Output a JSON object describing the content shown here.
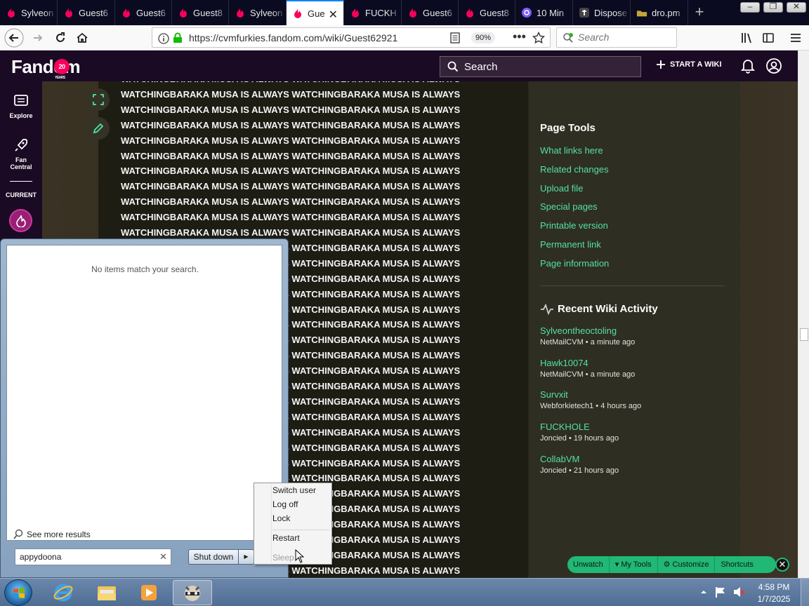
{
  "browser": {
    "tabs": [
      {
        "label": "Sylveon",
        "icon": "fandom-icon"
      },
      {
        "label": "Guest6",
        "icon": "fandom-icon"
      },
      {
        "label": "Guest6",
        "icon": "fandom-icon"
      },
      {
        "label": "Guest8",
        "icon": "fandom-icon"
      },
      {
        "label": "Sylveon",
        "icon": "fandom-icon"
      },
      {
        "label": "Gue",
        "icon": "fandom-icon",
        "active": true
      },
      {
        "label": "FUCKH",
        "icon": "fandom-icon"
      },
      {
        "label": "Guest6",
        "icon": "fandom-icon"
      },
      {
        "label": "Guest8",
        "icon": "fandom-icon"
      },
      {
        "label": "10 Min",
        "icon": "at-icon"
      },
      {
        "label": "Dispose",
        "icon": "t-icon"
      },
      {
        "label": "dro.pm",
        "icon": "dro-icon"
      }
    ],
    "url": "https://cvmfurkies.fandom.com/wiki/Guest62921",
    "zoom": "90%",
    "search_placeholder": "Search"
  },
  "fandom": {
    "logo": "Fandom",
    "logo_badge": "20",
    "logo_years": "YEARS",
    "search_label": "Search",
    "start_wiki": "START A WIKI",
    "nav": {
      "explore": "Explore",
      "fan_central_1": "Fan",
      "fan_central_2": "Central",
      "current": "CURRENT"
    }
  },
  "article": {
    "lines": [
      "WATCHINGBARAKA MUSA IS ALWAYS WATCHINGBARAKA MUSA IS ALWAYS",
      "WATCHINGBARAKA MUSA IS ALWAYS WATCHINGBARAKA MUSA IS ALWAYS",
      "WATCHINGBARAKA MUSA IS ALWAYS WATCHINGBARAKA MUSA IS ALWAYS",
      "WATCHINGBARAKA MUSA IS ALWAYS WATCHINGBARAKA MUSA IS ALWAYS",
      "WATCHINGBARAKA MUSA IS ALWAYS WATCHINGBARAKA MUSA IS ALWAYS",
      "WATCHINGBARAKA MUSA IS ALWAYS WATCHINGBARAKA MUSA IS ALWAYS",
      "WATCHINGBARAKA MUSA IS ALWAYS WATCHINGBARAKA MUSA IS ALWAYS",
      "WATCHINGBARAKA MUSA IS ALWAYS WATCHINGBARAKA MUSA IS ALWAYS",
      "WATCHINGBARAKA MUSA IS ALWAYS WATCHINGBARAKA MUSA IS ALWAYS",
      "WATCHINGBARAKA MUSA IS ALWAYS WATCHINGBARAKA MUSA IS ALWAYS",
      "WATCHINGBARAKA MUSA IS ALWAYS WATCHINGBARAKA MUSA IS ALWAYS",
      "WATCHINGBARAKA MUSA IS ALWAYS WATCHINGBARAKA MUSA IS ALWAYS",
      "WATCHINGBARAKA MUSA IS ALWAYS WATCHINGBARAKA MUSA IS ALWAYS",
      "WATCHINGBARAKA MUSA IS ALWAYS WATCHINGBARAKA MUSA IS ALWAYS",
      "WATCHINGBARAKA MUSA IS ALWAYS WATCHINGBARAKA MUSA IS ALWAYS",
      "WATCHINGBARAKA MUSA IS ALWAYS WATCHINGBARAKA MUSA IS ALWAYS",
      "WATCHINGBARAKA MUSA IS ALWAYS WATCHINGBARAKA MUSA IS ALWAYS",
      "WATCHINGBARAKA MUSA IS ALWAYS WATCHINGBARAKA MUSA IS ALWAYS",
      "WATCHINGBARAKA MUSA IS ALWAYS WATCHINGBARAKA MUSA IS ALWAYS",
      "WATCHINGBARAKA MUSA IS ALWAYS WATCHINGBARAKA MUSA IS ALWAYS",
      "WATCHINGBARAKA MUSA IS ALWAYS WATCHINGBARAKA MUSA IS ALWAYS",
      "WATCHINGBARAKA MUSA IS ALWAYS WATCHINGBARAKA MUSA IS ALWAYS",
      "WATCHINGBARAKA MUSA IS ALWAYS WATCHINGBARAKA MUSA IS ALWAYS",
      "WATCHINGBARAKA MUSA IS ALWAYS WATCHINGBARAKA MUSA IS ALWAYS",
      "WATCHINGBARAKA MUSA IS ALWAYS WATCHINGBARAKA MUSA IS ALWAYS",
      "WATCHINGBARAKA MUSA IS ALWAYS WATCHINGBARAKA MUSA IS ALWAYS",
      "WATCHINGBARAKA MUSA IS ALWAYS WATCHINGBARAKA MUSA IS ALWAYS",
      "WATCHINGBARAKA MUSA IS ALWAYS WATCHINGBARAKA MUSA IS ALWAYS",
      "WATCHINGBARAKA MUSA IS ALWAYS WATCHINGBARAKA MUSA IS ALWAYS",
      "WATCHINGBARAKA MUSA IS ALWAYS WATCHINGBARAKA MUSA IS ALWAYS",
      "WATCHINGBARAKA MUSA IS ALWAYS WATCHINGBARAKA MUSA IS ALWAYS",
      "WATCHINGBARAKA MUSA IS ALWAYS WATCHINGBARAKA MUSA IS ALWAYS",
      "WATCHINGBARAKA MUSA IS ALWAYS WATCHINGBARAKA MUSA IS ALWAYS",
      "WATCHINGBARAKA MUSA IS ALWAYS WATCHINGBARAKA MUSA IS ALWAYS"
    ]
  },
  "rail": {
    "page_tools_title": "Page Tools",
    "tools": [
      "What links here",
      "Related changes",
      "Upload file",
      "Special pages",
      "Printable version",
      "Permanent link",
      "Page information"
    ],
    "activity_title": "Recent Wiki Activity",
    "activity": [
      {
        "title": "Sylveontheoctoling",
        "meta": "NetMailCVM • a minute ago"
      },
      {
        "title": "Hawk10074",
        "meta": "NetMailCVM • a minute ago"
      },
      {
        "title": "Survxit",
        "meta": "Webforkietech1 • 4 hours ago"
      },
      {
        "title": "FUCKHOLE",
        "meta": "Joncied • 19 hours ago"
      },
      {
        "title": "CollabVM",
        "meta": "Joncied • 21 hours ago"
      }
    ]
  },
  "toolbar": {
    "unwatch": "Unwatch",
    "my_tools": "My Tools",
    "customize": "Customize",
    "shortcuts": "Shortcuts"
  },
  "startmenu": {
    "no_items": "No items match your search.",
    "see_more": "See more results",
    "search_value": "appydoona",
    "shutdown": "Shut down"
  },
  "context_menu": {
    "switch_user": "Switch user",
    "log_off": "Log off",
    "lock": "Lock",
    "restart": "Restart",
    "sleep": "Sleep"
  },
  "taskbar": {
    "time": "4:58 PM",
    "date": "1/7/2025"
  },
  "colors": {
    "fandom_dark": "#1b0a24",
    "link_green": "#54e0a2",
    "toolbar_green": "#21b774"
  }
}
